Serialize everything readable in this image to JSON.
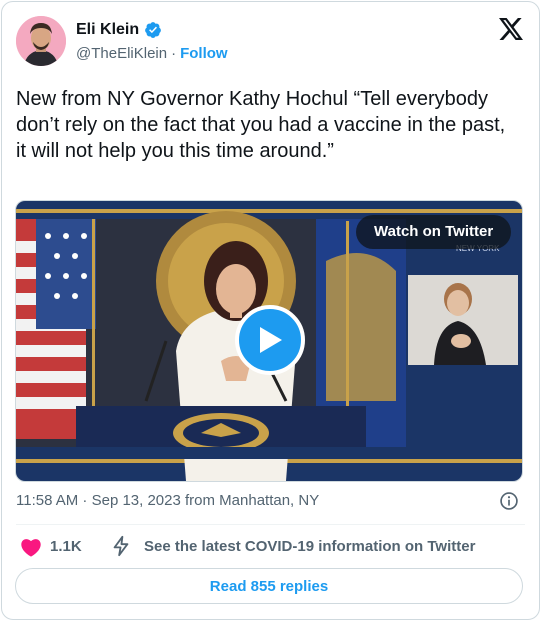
{
  "author": {
    "display_name": "Eli Klein",
    "handle": "@TheEliKlein",
    "separator": "·",
    "follow_label": "Follow"
  },
  "tweet": {
    "text": "New from NY Governor Kathy Hochul “Tell everybody don’t rely on the fact that you had a vaccine in the past, it will not help you this time around.”"
  },
  "media": {
    "watch_label": "Watch on Twitter"
  },
  "meta": {
    "timestamp": "11:58 AM · Sep 13, 2023 from Manhattan, NY"
  },
  "actions": {
    "like_count": "1.1K",
    "covid_link": "See the latest COVID-19 information on Twitter",
    "replies_label": "Read 855 replies"
  },
  "colors": {
    "accent": "#1d9bf0",
    "like": "#f91880",
    "text_secondary": "#536471"
  },
  "icons": [
    "verified-badge-icon",
    "x-logo-icon",
    "play-icon",
    "info-icon",
    "heart-icon",
    "lightning-bolt-icon"
  ]
}
